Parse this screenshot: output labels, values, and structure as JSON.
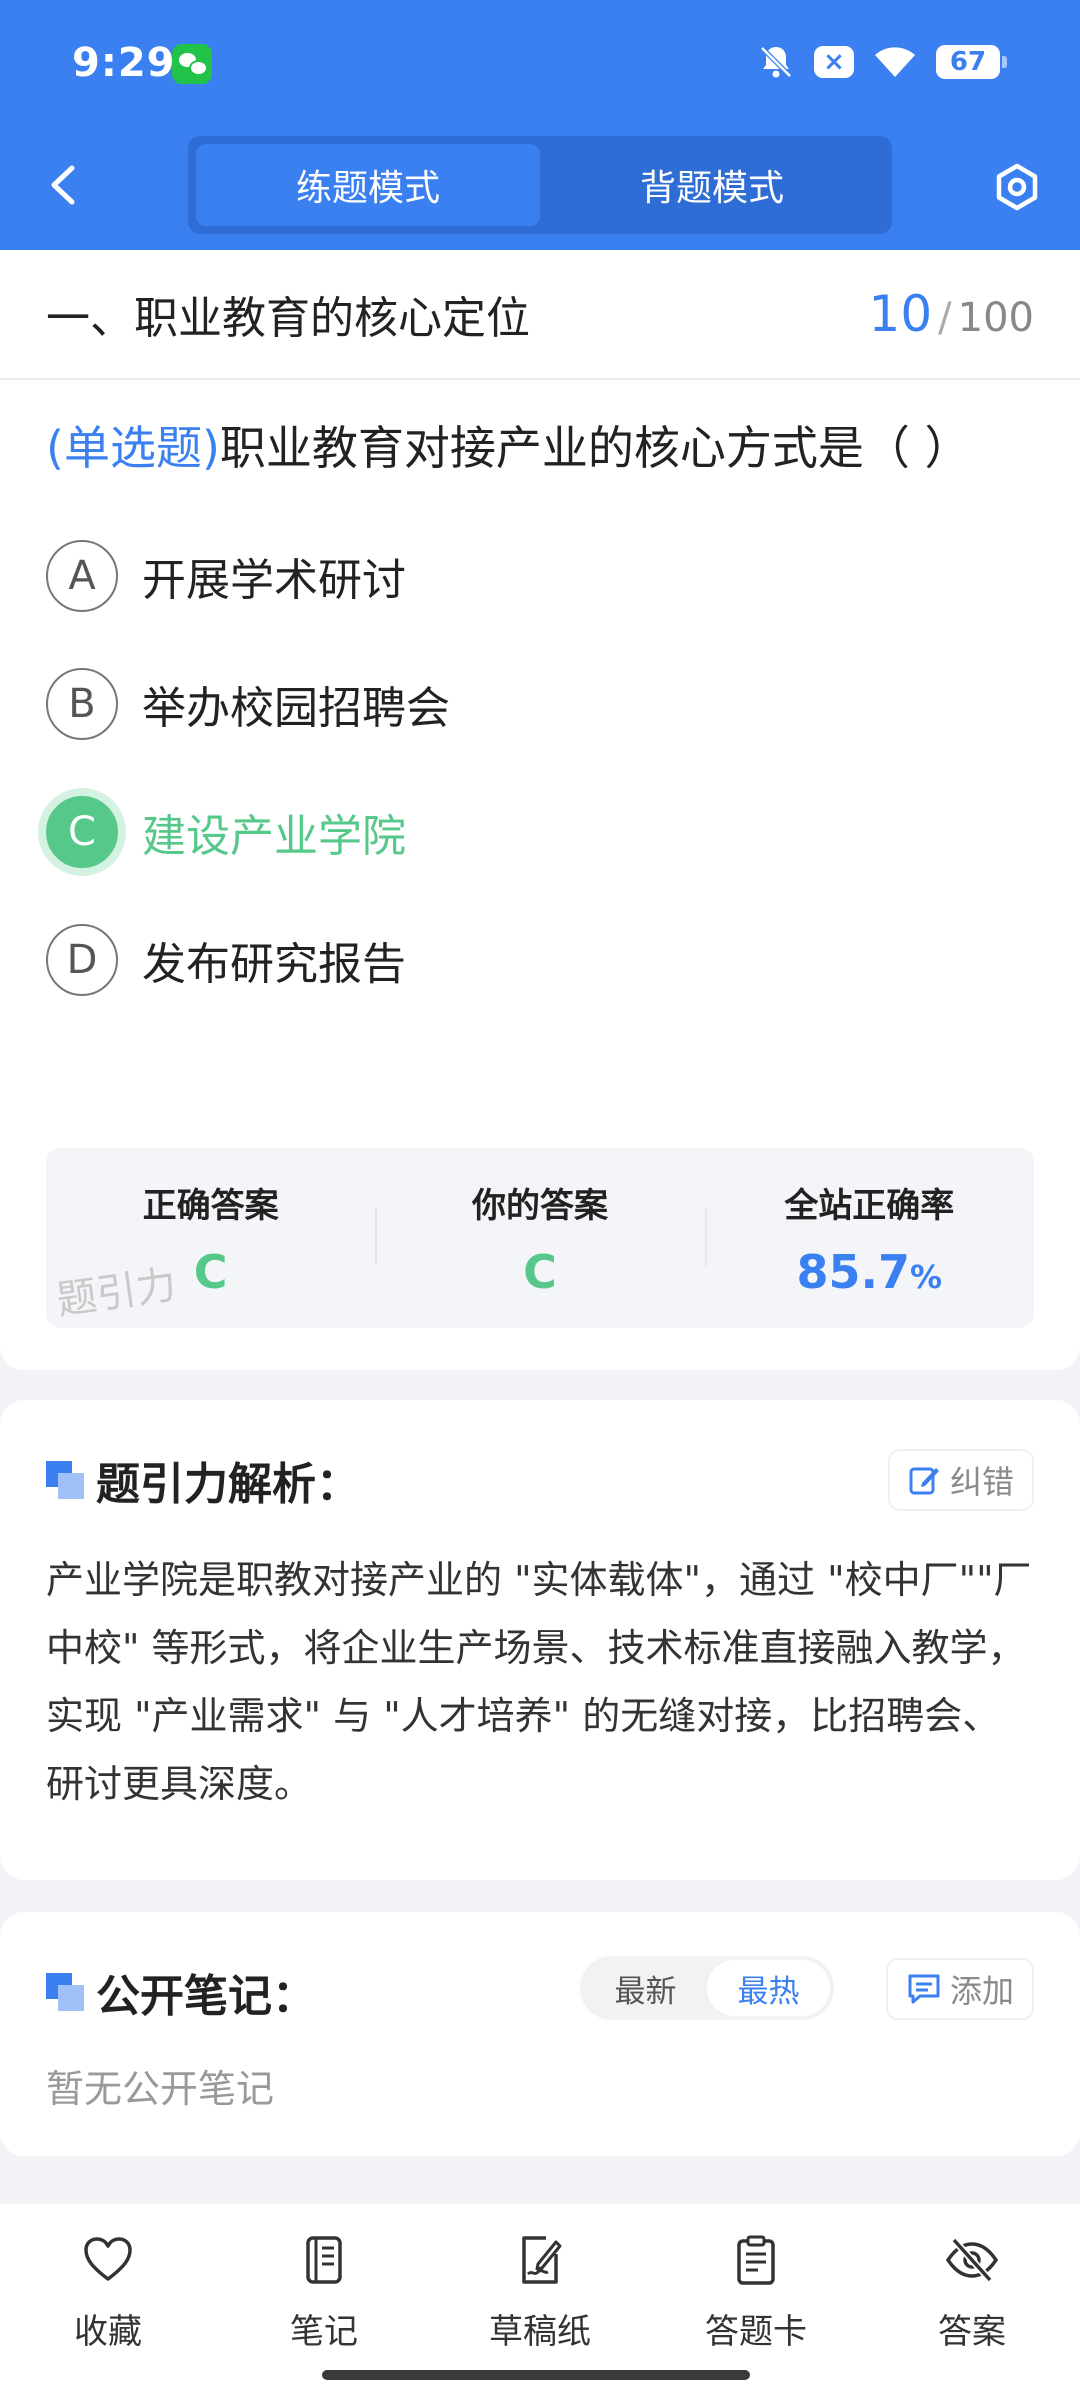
{
  "status_bar": {
    "time": "9:29",
    "battery": "67",
    "x_badge": "×"
  },
  "header": {
    "tabs": [
      {
        "label": "练题模式",
        "active": true
      },
      {
        "label": "背题模式",
        "active": false
      }
    ],
    "accent_color": "#3b80f0"
  },
  "section": {
    "title": "一、职业教育的核心定位",
    "current": "10",
    "separator": "/",
    "total": "100"
  },
  "question": {
    "type": "(单选题)",
    "text": "职业教育对接产业的核心方式是（ ）",
    "options": [
      {
        "letter": "A",
        "text": "开展学术研讨"
      },
      {
        "letter": "B",
        "text": "举办校园招聘会"
      },
      {
        "letter": "C",
        "text": "建设产业学院",
        "correct": true
      },
      {
        "letter": "D",
        "text": "发布研究报告"
      }
    ]
  },
  "answer_summary": {
    "correct_label": "正确答案",
    "correct_value": "C",
    "yours_label": "你的答案",
    "yours_value": "C",
    "rate_label": "全站正确率",
    "rate_value": "85.7",
    "rate_unit": "%",
    "watermark": "题引力"
  },
  "analysis": {
    "title": "题引力解析：",
    "correct_btn": "纠错",
    "text": "产业学院是职教对接产业的 \"实体载体\"，通过 \"校中厂\"\"厂中校\" 等形式，将企业生产场景、技术标准直接融入教学，实现 \"产业需求\" 与 \"人才培养\" 的无缝对接，比招聘会、研讨更具深度。"
  },
  "notes": {
    "title": "公开笔记：",
    "sort": [
      {
        "label": "最新",
        "active": false
      },
      {
        "label": "最热",
        "active": true
      }
    ],
    "add_btn": "添加",
    "empty": "暂无公开笔记"
  },
  "bottom_bar": [
    {
      "label": "收藏",
      "icon": "heart-icon"
    },
    {
      "label": "笔记",
      "icon": "notebook-icon"
    },
    {
      "label": "草稿纸",
      "icon": "draft-icon"
    },
    {
      "label": "答题卡",
      "icon": "clipboard-icon"
    },
    {
      "label": "答案",
      "icon": "eye-off-icon"
    }
  ]
}
